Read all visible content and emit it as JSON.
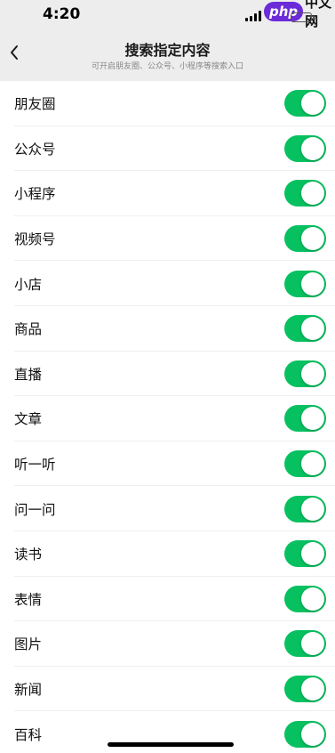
{
  "status_bar": {
    "time": "4:20"
  },
  "watermark": {
    "logo": "php",
    "text": "中文网"
  },
  "header": {
    "title": "搜索指定内容",
    "subtitle": "可开启朋友圈、公众号、小程序等搜索入口"
  },
  "colors": {
    "toggle_on": "#07c160",
    "nav_bg": "#ededed"
  },
  "settings": [
    {
      "label": "朋友圈",
      "enabled": true
    },
    {
      "label": "公众号",
      "enabled": true
    },
    {
      "label": "小程序",
      "enabled": true
    },
    {
      "label": "视频号",
      "enabled": true
    },
    {
      "label": "小店",
      "enabled": true
    },
    {
      "label": "商品",
      "enabled": true
    },
    {
      "label": "直播",
      "enabled": true
    },
    {
      "label": "文章",
      "enabled": true
    },
    {
      "label": "听一听",
      "enabled": true
    },
    {
      "label": "问一问",
      "enabled": true
    },
    {
      "label": "读书",
      "enabled": true
    },
    {
      "label": "表情",
      "enabled": true
    },
    {
      "label": "图片",
      "enabled": true
    },
    {
      "label": "新闻",
      "enabled": true
    },
    {
      "label": "百科",
      "enabled": true
    }
  ]
}
